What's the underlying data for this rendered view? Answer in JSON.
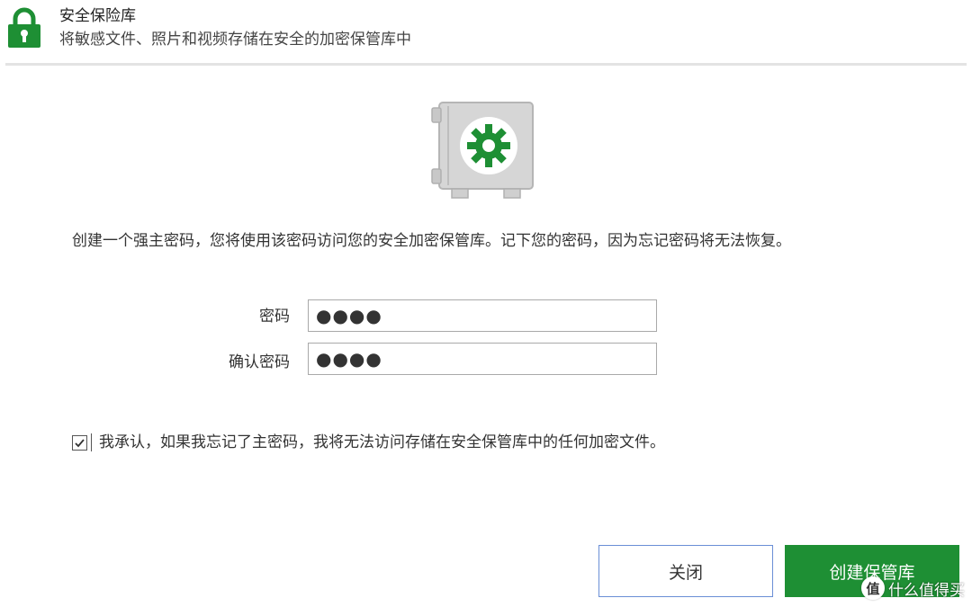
{
  "header": {
    "title": "安全保险库",
    "subtitle": "将敏感文件、照片和视频存储在安全的加密保管库中",
    "icon": "lock-icon",
    "accent_color": "#1e8f34"
  },
  "main": {
    "vault_icon": "vault-gear-icon",
    "description": "创建一个强主密码，您将使用该密码访问您的安全加密保管库。记下您的密码，因为忘记密码将无法恢复。",
    "password": {
      "label": "密码",
      "value": "●●●●"
    },
    "confirm": {
      "label": "确认密码",
      "value": "●●●●"
    },
    "acknowledge": {
      "checked": true,
      "text": "我承认，如果我忘记了主密码，我将无法访问存储在安全保管库中的任何加密文件。"
    }
  },
  "footer": {
    "close_label": "关闭",
    "create_label": "创建保管库",
    "create_color": "#1e8f34"
  },
  "watermark": {
    "logo": "值",
    "text": "什么值得买"
  }
}
